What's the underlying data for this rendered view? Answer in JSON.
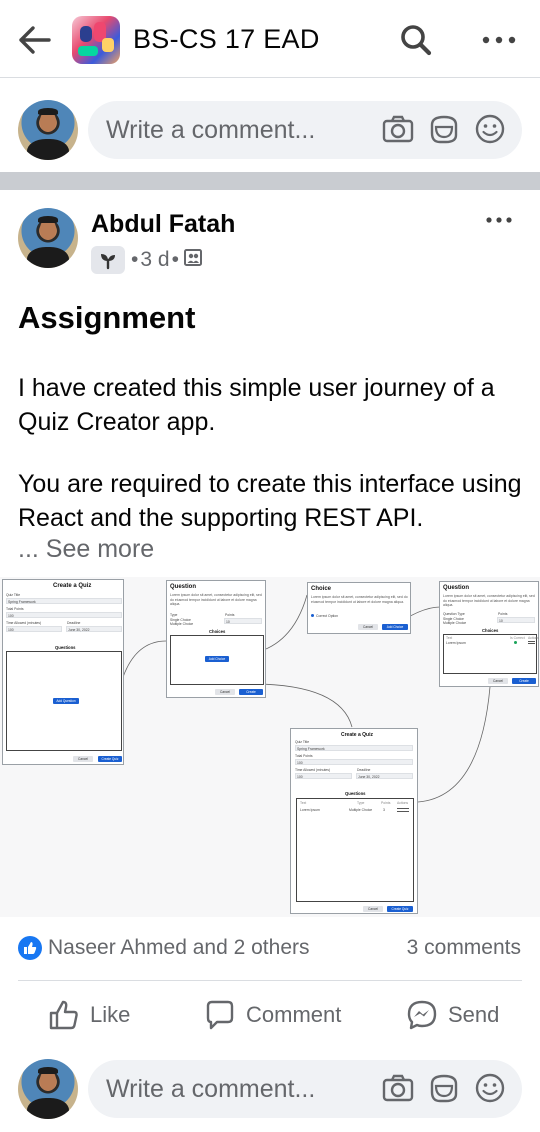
{
  "header": {
    "group_title": "BS-CS 17 EAD",
    "back_icon": "back-arrow-icon",
    "search_icon": "search-icon",
    "more_icon": "more-horizontal-icon"
  },
  "composer_top": {
    "placeholder": "Write a comment..."
  },
  "post": {
    "author": "Abdul Fatah",
    "time": "3 d",
    "title": "Assignment",
    "paragraph_1": "I have created this simple user journey of a Quiz Creator app.",
    "paragraph_2": "You are required to create this interface using React and the supporting REST API.",
    "see_more": "... See more"
  },
  "attachment": {
    "create_quiz_title": "Create a Quiz",
    "quiz_title_label": "Quiz Title",
    "quiz_title_value": "Spring Framework",
    "total_points_label": "Total Points",
    "total_points_value": "100",
    "time_allowed_label": "Time Allowed (minutes)",
    "time_allowed_value": "100",
    "deadline_label": "Deadline",
    "deadline_value": "June 30, 2022",
    "questions_label": "Questions",
    "add_question": "Add Question",
    "cancel": "Cancel",
    "create_quiz": "Create Quiz",
    "question_title": "Question",
    "lorem": "Lorem ipsum dolor sit amet, consectetur adipiscing elit, sed do eiusmod tempor incididunt ut labore et dolore magna aliqua.",
    "type_label": "Type",
    "question_type_label": "Question Type",
    "points_label": "Points",
    "points_value": "10",
    "single_choice": "Single Choice",
    "multiple_choice": "Multiple Choice",
    "choices_label": "Choices",
    "add_choice": "Add Choice",
    "create": "Create",
    "choice_title": "Choice",
    "correct_option": "Correct Option",
    "text_col": "Text",
    "type_col": "Type",
    "points_col": "Points",
    "correct_col": "Is Correct",
    "actions_col": "Actions",
    "row_text": "Lorem Ipsum",
    "row_type": "Multiple Choice",
    "row_points": "3"
  },
  "engagement": {
    "reactions_text": "Naseer Ahmed and 2 others",
    "comments_text": "3 comments",
    "like_label": "Like",
    "comment_label": "Comment",
    "send_label": "Send"
  },
  "composer_bottom": {
    "placeholder": "Write a comment..."
  },
  "colors": {
    "brand_blue": "#1877f2",
    "secondary_text": "#65676b",
    "pill_bg": "#f0f2f5"
  }
}
